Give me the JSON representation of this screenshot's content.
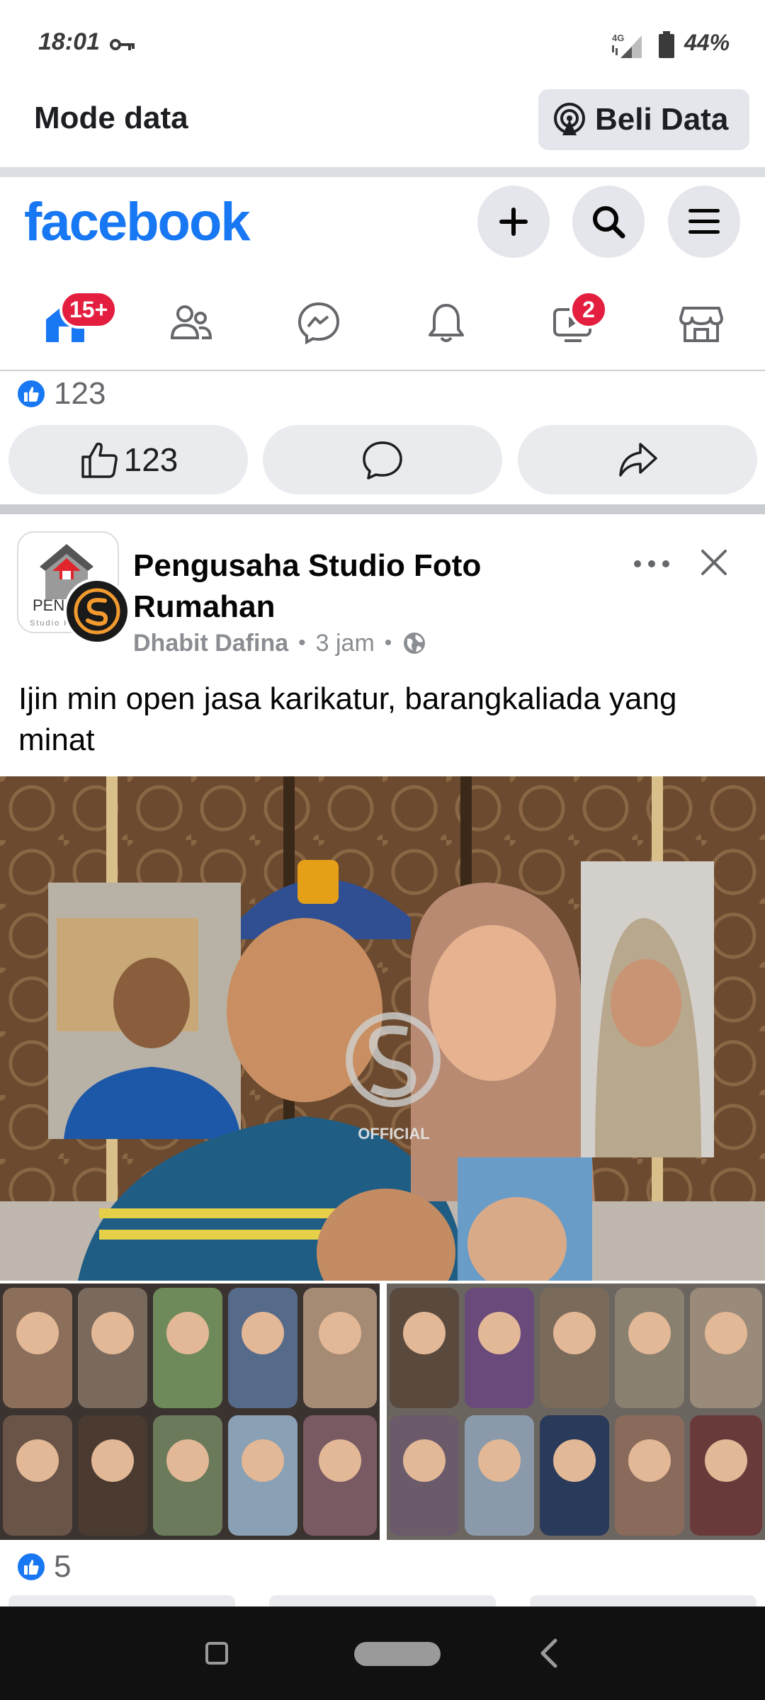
{
  "status_bar": {
    "time": "18:01",
    "network": "4G",
    "battery": "44%"
  },
  "data_mode": {
    "title": "Mode data",
    "buy_label": "Beli Data"
  },
  "header": {
    "logo": "facebook",
    "brand_color": "#1877f2"
  },
  "nav": {
    "home_badge": "15+",
    "video_badge": "2",
    "badge_color": "#e41e3f"
  },
  "previous_post": {
    "reaction_count": "123",
    "like_count": "123"
  },
  "post": {
    "group_name": "Pengusaha Studio Foto Rumahan",
    "author": "Dhabit Dafina",
    "time": "3 jam",
    "separator": "•",
    "text": "Ijin min open jasa karikatur, barangkaliada yang minat",
    "reaction_count": "5",
    "avatar_text": "PENG",
    "avatar_subtext": "Studio Fo",
    "watermark": "OFFICIAL"
  },
  "icons": {
    "create": "plus-icon",
    "search": "search-icon",
    "menu": "hamburger-icon",
    "home": "home-icon",
    "friends": "friends-icon",
    "messenger": "messenger-icon",
    "notifications": "bell-icon",
    "video": "video-icon",
    "marketplace": "marketplace-icon"
  }
}
